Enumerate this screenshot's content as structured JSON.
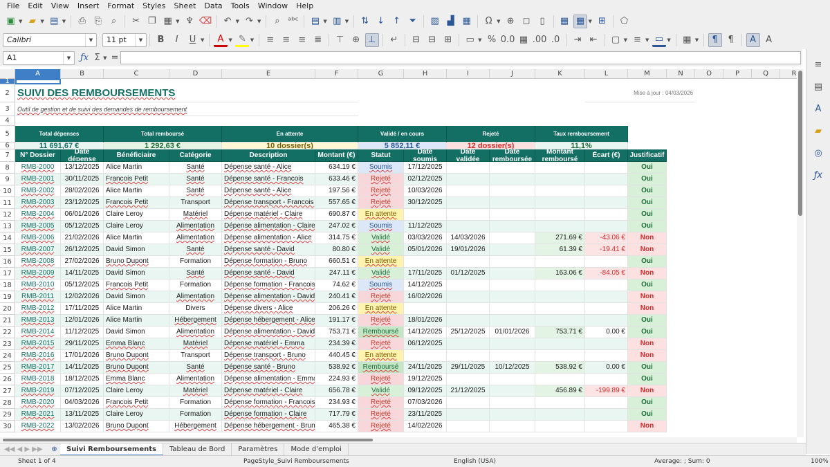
{
  "menu": [
    "File",
    "Edit",
    "View",
    "Insert",
    "Format",
    "Styles",
    "Sheet",
    "Data",
    "Tools",
    "Window",
    "Help"
  ],
  "toolbar": {
    "font_name": "Calibri",
    "font_size": "11 pt"
  },
  "formula": {
    "cell_ref": "A1"
  },
  "columns": [
    "A",
    "B",
    "C",
    "D",
    "E",
    "F",
    "G",
    "H",
    "I",
    "J",
    "K",
    "L",
    "M",
    "N",
    "O",
    "P",
    "Q",
    "R"
  ],
  "title": "SUIVI DES REMBOURSEMENTS",
  "subtitle": "Outil de gestion et de suivi des demandes de remboursement",
  "update": "Mise à jour : 04/03/2026",
  "summary": {
    "labels": [
      "Total dépenses",
      "Total remboursé",
      "En attente",
      "Validé / en cours",
      "Rejeté",
      "Taux remboursement"
    ],
    "values": [
      "11 691,67 €",
      "1 292,63 €",
      "10 dossier(s)",
      "5 852,11 €",
      "12 dossier(s)",
      "11,1%"
    ]
  },
  "headers": [
    "N° Dossier",
    "Date dépense",
    "Bénéficiaire",
    "Catégorie",
    "Description",
    "Montant (€)",
    "Statut",
    "Date soumis",
    "Date validée",
    "Date remboursée",
    "Montant remboursé",
    "Écart (€)",
    "Justificatif"
  ],
  "rows": [
    [
      "RMB-2000",
      "13/12/2025",
      "Alice Martin",
      "Santé",
      "Dépense santé - Alice",
      "634.19 €",
      "Soumis",
      "17/12/2025",
      "",
      "",
      "",
      "",
      "Oui"
    ],
    [
      "RMB-2001",
      "30/11/2025",
      "Francois Petit",
      "Santé",
      "Dépense santé - Francois",
      "633.46 €",
      "Rejeté",
      "02/12/2025",
      "",
      "",
      "",
      "",
      "Oui"
    ],
    [
      "RMB-2002",
      "28/02/2026",
      "Alice Martin",
      "Santé",
      "Dépense santé - Alice",
      "197.56 €",
      "Rejeté",
      "10/03/2026",
      "",
      "",
      "",
      "",
      "Oui"
    ],
    [
      "RMB-2003",
      "23/12/2025",
      "Francois Petit",
      "Transport",
      "Dépense transport - Francois",
      "557.65 €",
      "Rejeté",
      "30/12/2025",
      "",
      "",
      "",
      "",
      "Oui"
    ],
    [
      "RMB-2004",
      "06/01/2026",
      "Claire Leroy",
      "Matériel",
      "Dépense matériel - Claire",
      "690.87 €",
      "En attente",
      "",
      "",
      "",
      "",
      "",
      "Oui"
    ],
    [
      "RMB-2005",
      "05/12/2025",
      "Claire Leroy",
      "Alimentation",
      "Dépense alimentation - Claire",
      "247.02 €",
      "Soumis",
      "11/12/2025",
      "",
      "",
      "",
      "",
      "Oui"
    ],
    [
      "RMB-2006",
      "21/02/2026",
      "Alice Martin",
      "Alimentation",
      "Dépense alimentation - Alice",
      "314.75 €",
      "Validé",
      "03/03/2026",
      "14/03/2026",
      "",
      "271.69 €",
      "-43.06 €",
      "Non"
    ],
    [
      "RMB-2007",
      "26/12/2025",
      "David Simon",
      "Santé",
      "Dépense santé - David",
      "80.80 €",
      "Validé",
      "05/01/2026",
      "19/01/2026",
      "",
      "61.39 €",
      "-19.41 €",
      "Non"
    ],
    [
      "RMB-2008",
      "27/02/2026",
      "Bruno Dupont",
      "Formation",
      "Dépense formation - Bruno",
      "660.51 €",
      "En attente",
      "",
      "",
      "",
      "",
      "",
      "Oui"
    ],
    [
      "RMB-2009",
      "14/11/2025",
      "David Simon",
      "Santé",
      "Dépense santé - David",
      "247.11 €",
      "Validé",
      "17/11/2025",
      "01/12/2025",
      "",
      "163.06 €",
      "-84.05 €",
      "Non"
    ],
    [
      "RMB-2010",
      "05/12/2025",
      "Francois Petit",
      "Formation",
      "Dépense formation - Francois",
      "74.62 €",
      "Soumis",
      "14/12/2025",
      "",
      "",
      "",
      "",
      "Oui"
    ],
    [
      "RMB-2011",
      "12/02/2026",
      "David Simon",
      "Alimentation",
      "Dépense alimentation - David",
      "240.41 €",
      "Rejeté",
      "16/02/2026",
      "",
      "",
      "",
      "",
      "Non"
    ],
    [
      "RMB-2012",
      "17/11/2025",
      "Alice Martin",
      "Divers",
      "Dépense divers - Alice",
      "206.26 €",
      "En attente",
      "",
      "",
      "",
      "",
      "",
      "Non"
    ],
    [
      "RMB-2013",
      "12/01/2026",
      "Alice Martin",
      "Hébergement",
      "Dépense hébergement - Alice",
      "191.17 €",
      "Rejeté",
      "18/01/2026",
      "",
      "",
      "",
      "",
      "Oui"
    ],
    [
      "RMB-2014",
      "11/12/2025",
      "David Simon",
      "Alimentation",
      "Dépense alimentation - David",
      "753.71 €",
      "Remboursé",
      "14/12/2025",
      "25/12/2025",
      "01/01/2026",
      "753.71 €",
      "0.00 €",
      "Oui"
    ],
    [
      "RMB-2015",
      "29/11/2025",
      "Emma Blanc",
      "Matériel",
      "Dépense matériel - Emma",
      "234.39 €",
      "Rejeté",
      "06/12/2025",
      "",
      "",
      "",
      "",
      "Non"
    ],
    [
      "RMB-2016",
      "17/01/2026",
      "Bruno Dupont",
      "Transport",
      "Dépense transport - Bruno",
      "440.45 €",
      "En attente",
      "",
      "",
      "",
      "",
      "",
      "Non"
    ],
    [
      "RMB-2017",
      "14/11/2025",
      "Bruno Dupont",
      "Santé",
      "Dépense santé - Bruno",
      "538.92 €",
      "Remboursé",
      "24/11/2025",
      "29/11/2025",
      "10/12/2025",
      "538.92 €",
      "0.00 €",
      "Oui"
    ],
    [
      "RMB-2018",
      "18/12/2025",
      "Emma Blanc",
      "Alimentation",
      "Dépense alimentation - Emma",
      "224.93 €",
      "Rejeté",
      "19/12/2025",
      "",
      "",
      "",
      "",
      "Oui"
    ],
    [
      "RMB-2019",
      "07/12/2025",
      "Claire Leroy",
      "Matériel",
      "Dépense matériel - Claire",
      "656.78 €",
      "Validé",
      "09/12/2025",
      "21/12/2025",
      "",
      "456.89 €",
      "-199.89 €",
      "Non"
    ],
    [
      "RMB-2020",
      "04/03/2026",
      "Francois Petit",
      "Formation",
      "Dépense formation - Francois",
      "234.93 €",
      "Rejeté",
      "07/03/2026",
      "",
      "",
      "",
      "",
      "Oui"
    ],
    [
      "RMB-2021",
      "13/11/2025",
      "Claire Leroy",
      "Formation",
      "Dépense formation - Claire",
      "717.79 €",
      "Rejeté",
      "23/11/2025",
      "",
      "",
      "",
      "",
      "Oui"
    ],
    [
      "RMB-2022",
      "13/02/2026",
      "Bruno Dupont",
      "Hébergement",
      "Dépense hébergement - Bruno",
      "465.38 €",
      "Rejeté",
      "14/02/2026",
      "",
      "",
      "",
      "",
      "Non"
    ]
  ],
  "tabs": [
    "Suivi Remboursements",
    "Tableau de Bord",
    "Paramètres",
    "Mode d'emploi"
  ],
  "status": {
    "sheet": "Sheet 1 of 4",
    "pagestyle": "PageStyle_Suivi Remboursements",
    "lang": "English (USA)",
    "sum": "Average: ; Sum: 0",
    "zoom": "100%"
  }
}
